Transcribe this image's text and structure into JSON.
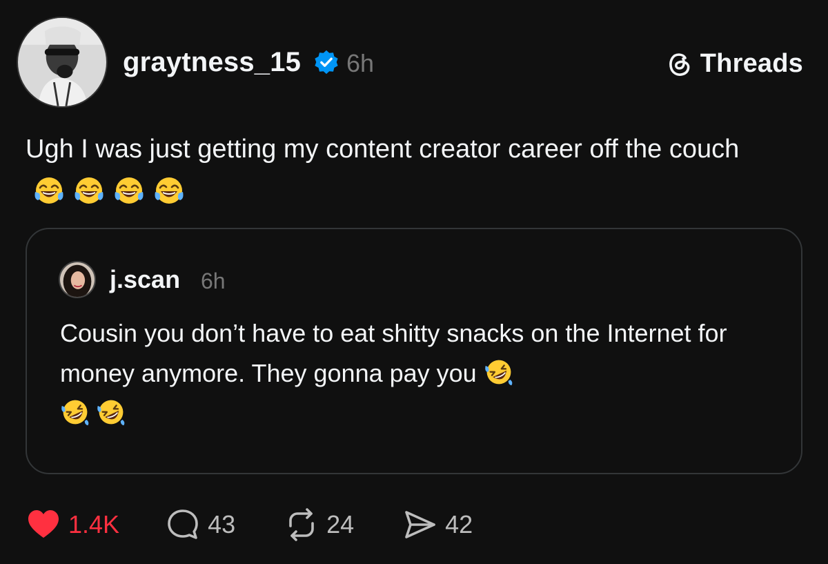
{
  "colors": {
    "background": "#101010",
    "text": "#f3f5f7",
    "muted": "#777777",
    "like": "#ff3040",
    "verified": "#0095f6",
    "card_border": "#333638"
  },
  "header": {
    "avatar_icon": "profile-photo",
    "username": "graytness_15",
    "verified_icon": "verified-badge-icon",
    "time": "6h",
    "brand_icon": "threads-logo-icon",
    "brand_label": "Threads"
  },
  "post": {
    "text": "Ugh I was just getting my content creator career off the couch",
    "emoji": [
      "face-with-tears-of-joy",
      "face-with-tears-of-joy",
      "face-with-tears-of-joy",
      "face-with-tears-of-joy"
    ]
  },
  "quote": {
    "avatar_icon": "profile-photo",
    "username": "j.scan",
    "time": "6h",
    "text": "Cousin you don’t have to eat shitty snacks on the Internet for money anymore. They gonna pay you",
    "emoji": [
      "rolling-on-the-floor-laughing",
      "rolling-on-the-floor-laughing",
      "rolling-on-the-floor-laughing"
    ]
  },
  "actions": {
    "like": {
      "icon": "heart-icon",
      "count": "1.4K"
    },
    "reply": {
      "icon": "comment-icon",
      "count": "43"
    },
    "repost": {
      "icon": "repost-icon",
      "count": "24"
    },
    "share": {
      "icon": "send-icon",
      "count": "42"
    }
  }
}
